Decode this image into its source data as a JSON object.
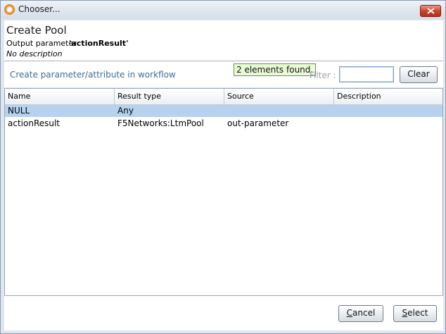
{
  "window": {
    "title": "Chooser..."
  },
  "header": {
    "title": "Create Pool",
    "param_label": "Output parameter",
    "param_value": "'actionResult'",
    "description": "No description"
  },
  "toolbar": {
    "create_link": "Create parameter/attribute in workflow",
    "found_tooltip": "2 elements found.",
    "filter_label": "Filter :",
    "filter_value": "",
    "clear_label": "Clear"
  },
  "table": {
    "columns": [
      "Name",
      "Result type",
      "Source",
      "Description"
    ],
    "rows": [
      {
        "name": "NULL",
        "result_type": "Any",
        "source": "",
        "description": "",
        "selected": true
      },
      {
        "name": "actionResult",
        "result_type": "F5Networks:LtmPool",
        "source": "out-parameter",
        "description": "",
        "selected": false
      }
    ]
  },
  "footer": {
    "cancel_label": "Cancel",
    "select_label": "Select"
  },
  "colors": {
    "selection": "#b7d2ef",
    "tooltip_bg": "#e9fbd6",
    "link": "#3f6d98",
    "close_button": "#c9462e"
  }
}
